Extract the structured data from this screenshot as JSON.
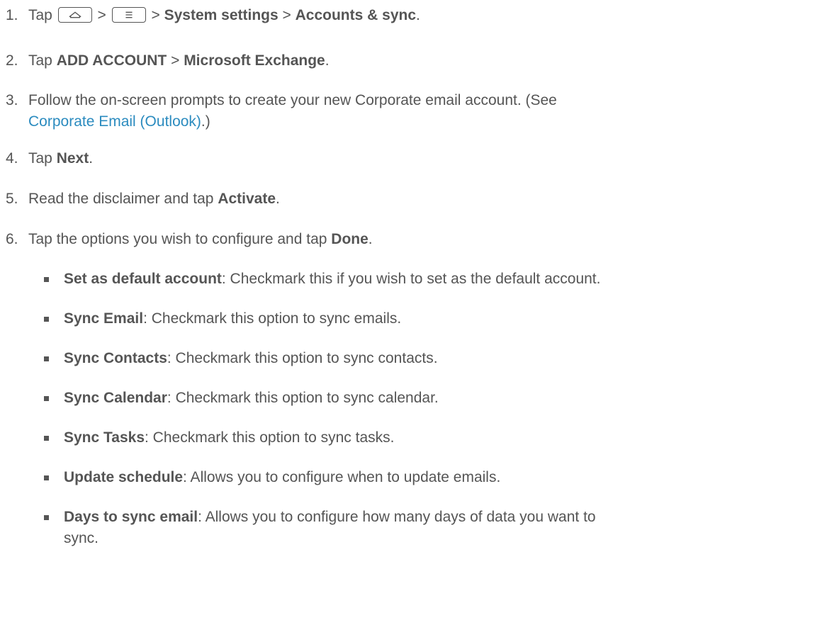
{
  "steps": [
    {
      "num": "1.",
      "pre": "Tap",
      "sep1": ">",
      "sep2": ">",
      "b1": "System settings",
      "sep3": ">",
      "b2": "Accounts & sync",
      "end": ".",
      "icons": [
        "home-key-icon",
        "menu-key-icon"
      ]
    },
    {
      "num": "2.",
      "pre": "Tap ",
      "b1": "ADD ACCOUNT",
      "mid": " > ",
      "b2": "Microsoft Exchange",
      "end": "."
    },
    {
      "num": "3.",
      "line1": "Follow the on-screen prompts to create your new Corporate email account. (See",
      "link": "Corporate Email (Outlook)",
      "end": ".)"
    },
    {
      "num": "4.",
      "pre": "Tap ",
      "b1": "Next",
      "end": "."
    },
    {
      "num": "5.",
      "pre": "Read the disclaimer and tap ",
      "b1": "Activate",
      "end": "."
    },
    {
      "num": "6.",
      "pre": "Tap the options you wish to configure and tap ",
      "b1": "Done",
      "end": "."
    }
  ],
  "options": [
    {
      "label": "Set as default account",
      "desc": ": Checkmark this if you wish to set as the default account."
    },
    {
      "label": "Sync Email",
      "desc": ": Checkmark this option to sync emails."
    },
    {
      "label": "Sync Contacts",
      "desc": ": Checkmark this option to sync contacts."
    },
    {
      "label": "Sync Calendar",
      "desc": ": Checkmark this option to sync calendar."
    },
    {
      "label": "Sync Tasks",
      "desc": ": Checkmark this option to sync tasks."
    },
    {
      "label": "Update schedule",
      "desc": ": Allows you to configure when to update emails."
    },
    {
      "label": "Days to sync email",
      "desc": ": Allows you to configure how many days of data you want to",
      "desc2": "sync."
    }
  ]
}
